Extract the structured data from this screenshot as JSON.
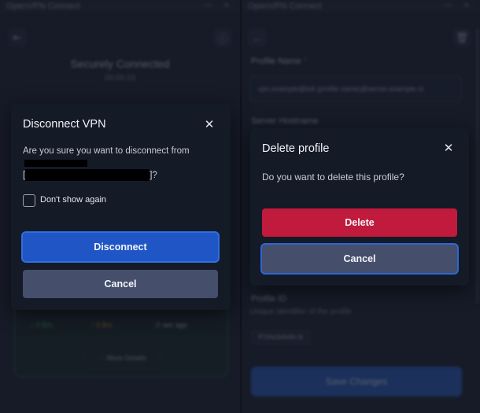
{
  "left_window": {
    "title": "OpenVPN Connect",
    "window_controls": "—  ×",
    "back_icon": "⇤",
    "info_icon": "ⓘ",
    "status_title": "Securely Connected",
    "status_sub": "00:00:23",
    "stats": {
      "received": "↓ 0 B/s",
      "sent": "↑ 0 B/s",
      "time": "⏱ sec ago"
    },
    "more_details": "⋯  More Details"
  },
  "right_window": {
    "title": "OpenVPN Connect",
    "window_controls": "—  ×",
    "back_icon": "←",
    "delete_icon": "🗑",
    "profile_name_label": "Profile Name",
    "required_mark": "*",
    "profile_name_value": "vpn.example@bdl (profile name)@server.example.nl",
    "server_hostname_label": "Server Hostname",
    "profile_id_label": "Profile ID",
    "profile_id_hint": "Unique identifier of the profile",
    "profile_id_chip": "ff7d4a3a6e8e  ⧉",
    "save_button": "Save Changes"
  },
  "disconnect_dialog": {
    "title": "Disconnect VPN",
    "close_icon": "✕",
    "message_line1": "Are you sure you want to disconnect from",
    "bracket_open": "[",
    "bracket_close": "]?",
    "checkbox_label": "Don't show again",
    "disconnect_button": "Disconnect",
    "cancel_button": "Cancel"
  },
  "delete_dialog": {
    "title": "Delete profile",
    "close_icon": "✕",
    "message": "Do you want to delete this profile?",
    "delete_button": "Delete",
    "cancel_button": "Cancel"
  },
  "colors": {
    "background": "#1b1f2c",
    "dialog": "#151a27",
    "primary": "#1f55c4",
    "danger": "#c01a3c",
    "neutral": "#454e6a"
  }
}
